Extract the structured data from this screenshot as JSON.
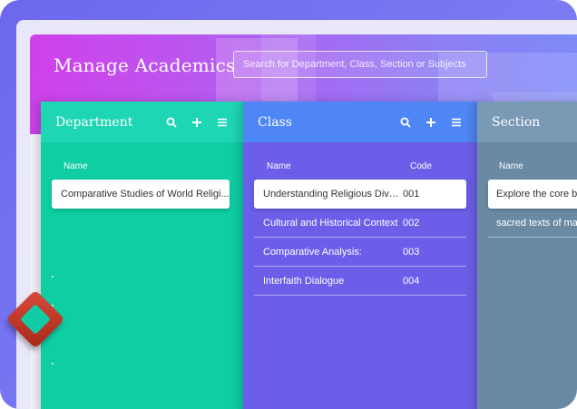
{
  "app": {
    "title": "Manage Academics",
    "search_placeholder": "Search for Department, Class, Section or Subjects"
  },
  "department": {
    "title": "Department",
    "col_name": "Name",
    "items": [
      {
        "name": "Comparative Studies of World Religi..."
      }
    ]
  },
  "class": {
    "title": "Class",
    "col_name": "Name",
    "col_code": "Code",
    "items": [
      {
        "name": "Understanding Religious Diver...",
        "code": "001"
      },
      {
        "name": "Cultural and Historical Context",
        "code": "002"
      },
      {
        "name": "Comparative Analysis:",
        "code": "003"
      },
      {
        "name": "Interfaith Dialogue",
        "code": "004"
      }
    ]
  },
  "section": {
    "title": "Section",
    "col_name": "Name",
    "items": [
      {
        "name": "Explore the core beliefs"
      },
      {
        "name": "sacred texts of major"
      }
    ]
  },
  "icons": [
    "search-icon",
    "plus-icon",
    "menu-icon"
  ],
  "colors": {
    "department_panel": "#0fcea3",
    "class_panel": "#6b5fe9",
    "class_header": "#4f86f6",
    "section_panel": "#6a8aa4",
    "accent": "#cf41e9"
  }
}
